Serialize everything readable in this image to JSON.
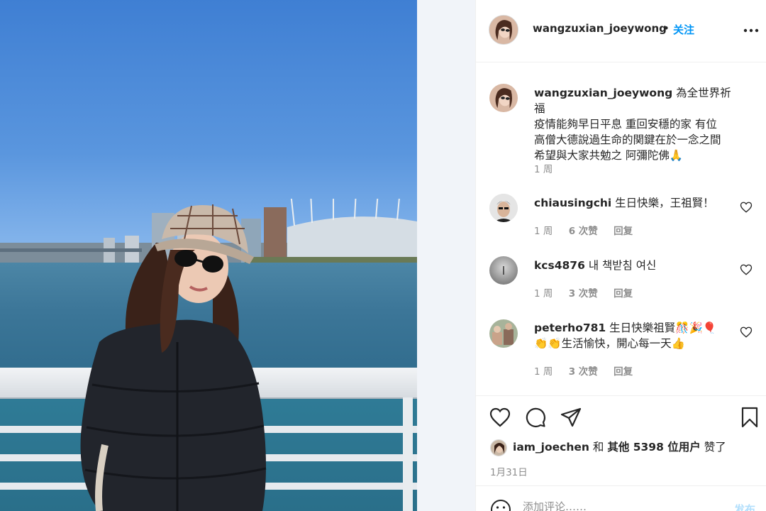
{
  "post": {
    "username": "wangzuxian_joeywong",
    "dot": "•",
    "follow_label": "关注",
    "caption": {
      "username": "wangzuxian_joeywong",
      "lines": [
        "為全世界祈福",
        "疫情能夠早日平息 重回安穩的家 有位",
        "高僧大德說過生命的関鍵在於一念之間",
        "希望與大家共勉之 阿彌陀佛🙏"
      ],
      "time": "1 周"
    },
    "comments": [
      {
        "username": "chiausingchi",
        "text": "生日快樂，王祖賢！",
        "time": "1 周",
        "likes": "6 次赞",
        "reply": "回复"
      },
      {
        "username": "kcs4876",
        "text": "내 책받침 여신",
        "time": "1 周",
        "likes": "3 次赞",
        "reply": "回复"
      },
      {
        "username": "peterho781",
        "text": "生日快樂祖賢🎊🎉🎈",
        "text2": "👏👏生活愉快，開心每一天👍",
        "time": "1 周",
        "likes": "3 次赞",
        "reply": "回复"
      }
    ],
    "likes": {
      "user": "iam_joechen",
      "and": "和",
      "others": "其他 5398 位用户",
      "suffix": "赞了"
    },
    "date": "1月31日",
    "add_comment": {
      "placeholder": "添加评论……",
      "post_label": "发布"
    }
  },
  "icons": {
    "more": "more-icon",
    "heart": "heart-icon",
    "comment": "comment-icon",
    "share": "share-icon",
    "bookmark": "bookmark-icon",
    "emoji": "emoji-icon"
  },
  "colors": {
    "link": "#0095f6",
    "muted": "#8e8e8e",
    "text": "#262626",
    "post_disabled": "#b2dffc"
  }
}
